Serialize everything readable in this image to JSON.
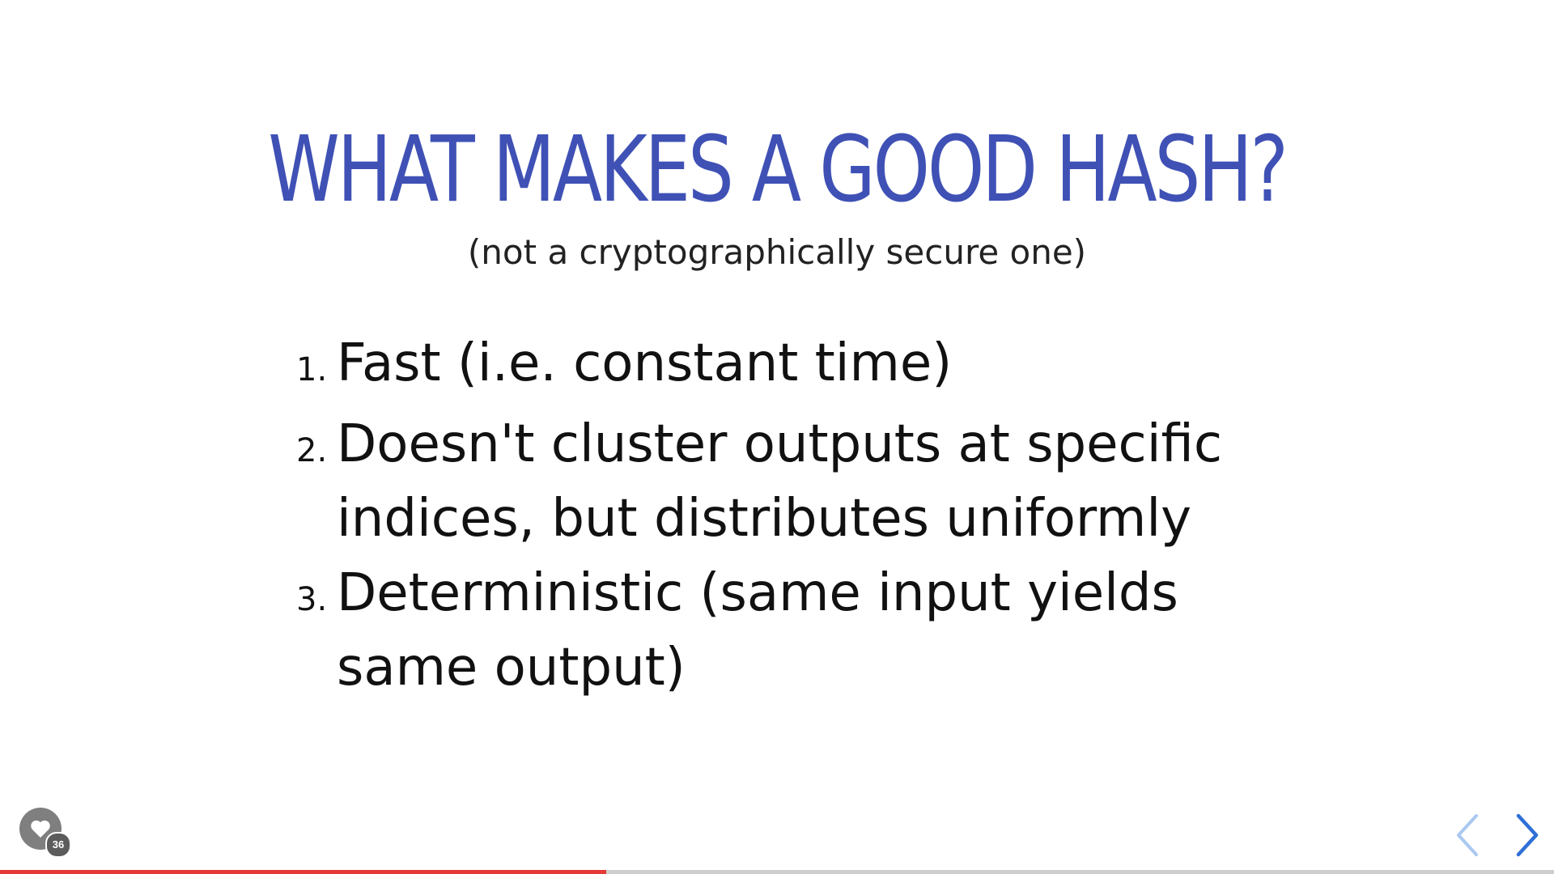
{
  "slide": {
    "title": "WHAT MAKES A GOOD HASH?",
    "subtitle": "(not a cryptographically secure one)",
    "items": [
      {
        "number": "1.",
        "text": "Fast (i.e. constant time)"
      },
      {
        "number": "2.",
        "text": "Doesn't cluster outputs at specific indices, but distributes uniformly"
      },
      {
        "number": "3.",
        "text": "Deterministic (same input yields same output)"
      }
    ]
  },
  "controls": {
    "like_count": "36",
    "prev_icon": "chevron-left-icon",
    "next_icon": "chevron-right-icon",
    "like_icon": "heart-icon"
  },
  "progress": {
    "fraction": 0.39
  },
  "colors": {
    "title": "#3f51b5",
    "progress": "#e53935",
    "nav_prev": "#aac8f0",
    "nav_next": "#2f6fd6"
  }
}
